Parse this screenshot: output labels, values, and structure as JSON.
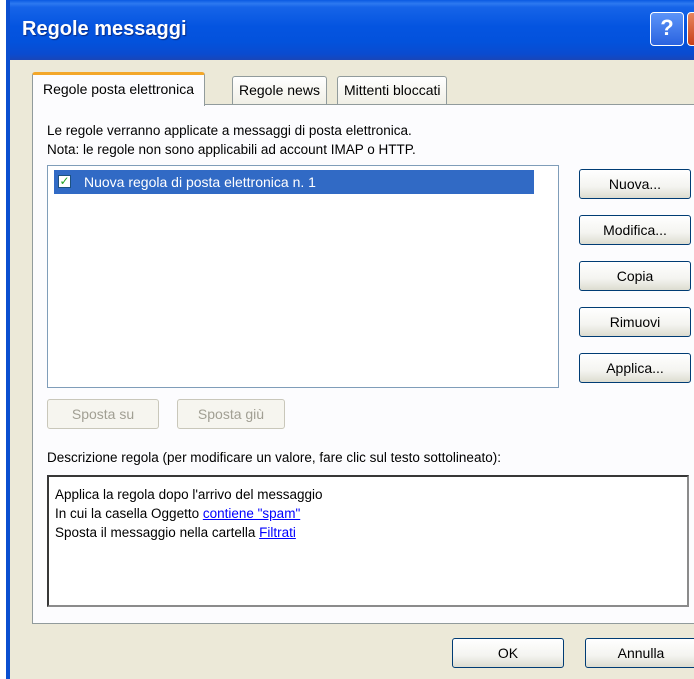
{
  "window": {
    "title": "Regole messaggi",
    "help_glyph": "?",
    "close_glyph": "X"
  },
  "tabs": [
    {
      "label": "Regole posta elettronica",
      "active": true
    },
    {
      "label": "Regole news",
      "active": false
    },
    {
      "label": "Mittenti bloccati",
      "active": false
    }
  ],
  "info": {
    "line1": "Le regole verranno applicate a messaggi di posta elettronica.",
    "line2": "Nota: le regole non sono applicabili ad account IMAP o HTTP."
  },
  "rules": [
    {
      "label": "Nuova regola di posta elettronica n. 1",
      "checked": true,
      "selected": true
    }
  ],
  "side_buttons": {
    "new": "Nuova...",
    "edit": "Modifica...",
    "copy": "Copia",
    "remove": "Rimuovi",
    "apply": "Applica..."
  },
  "move_buttons": {
    "up": "Sposta su",
    "down": "Sposta giù"
  },
  "description": {
    "label": "Descrizione regola (per modificare un valore, fare clic sul testo sottolineato):",
    "line1": "Applica la regola dopo l'arrivo del messaggio",
    "line2_prefix": "In cui la casella Oggetto ",
    "line2_link": "contiene \"spam\"",
    "line3_prefix": "Sposta il messaggio nella cartella ",
    "line3_link": "Filtrati"
  },
  "footer": {
    "ok": "OK",
    "cancel": "Annulla"
  },
  "colors": {
    "titlebar": "#0454e0",
    "selection": "#316ac5",
    "active_tab_accent": "#f3a72a",
    "link": "#0000ff"
  }
}
